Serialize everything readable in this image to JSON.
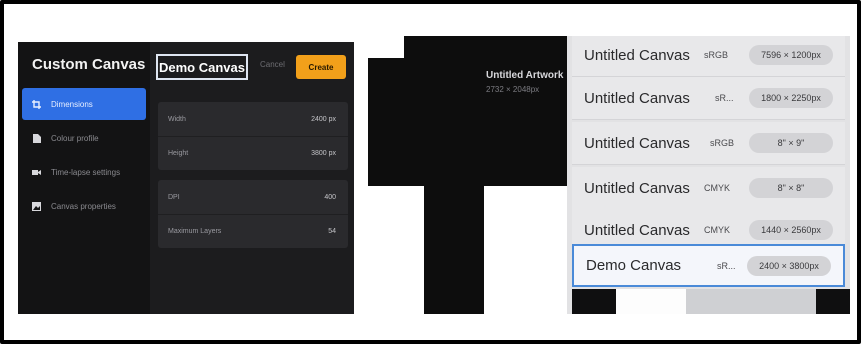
{
  "custom_canvas": {
    "title": "Custom Canvas",
    "name_value": "Demo Canvas",
    "cancel_label": "Cancel",
    "create_label": "Create",
    "create_color": "#f2a01a",
    "accent_color": "#2f6fe4",
    "sidebar": [
      {
        "label": "Dimensions",
        "icon": "crop-icon",
        "active": true
      },
      {
        "label": "Colour profile",
        "icon": "document-icon",
        "active": false
      },
      {
        "label": "Time-lapse settings",
        "icon": "video-camera-icon",
        "active": false
      },
      {
        "label": "Canvas properties",
        "icon": "image-icon",
        "active": false
      }
    ],
    "size_group": [
      {
        "label": "Width",
        "value": "2400 px"
      },
      {
        "label": "Height",
        "value": "3800 px"
      }
    ],
    "props_group": [
      {
        "label": "DPI",
        "value": "400"
      },
      {
        "label": "Maximum Layers",
        "value": "54"
      }
    ]
  },
  "artwork": {
    "title": "Untitled Artwork",
    "size": "2732 × 2048px"
  },
  "canvas_list": [
    {
      "name": "Untitled Canvas",
      "profile": "sRGB",
      "size": "7596 × 1200px",
      "selected": false
    },
    {
      "name": "Untitled Canvas",
      "profile": "sR...",
      "size": "1800 × 2250px",
      "selected": false
    },
    {
      "name": "Untitled Canvas",
      "profile": "sRGB",
      "size": "8\" × 9\"",
      "selected": false
    },
    {
      "name": "Untitled Canvas",
      "profile": "CMYK",
      "size": "8\" × 8\"",
      "selected": false
    },
    {
      "name": "Untitled Canvas",
      "profile": "CMYK",
      "size": "1440 × 2560px",
      "selected": false
    },
    {
      "name": "Demo Canvas",
      "profile": "sR...",
      "size": "2400 × 3800px",
      "selected": true
    }
  ]
}
